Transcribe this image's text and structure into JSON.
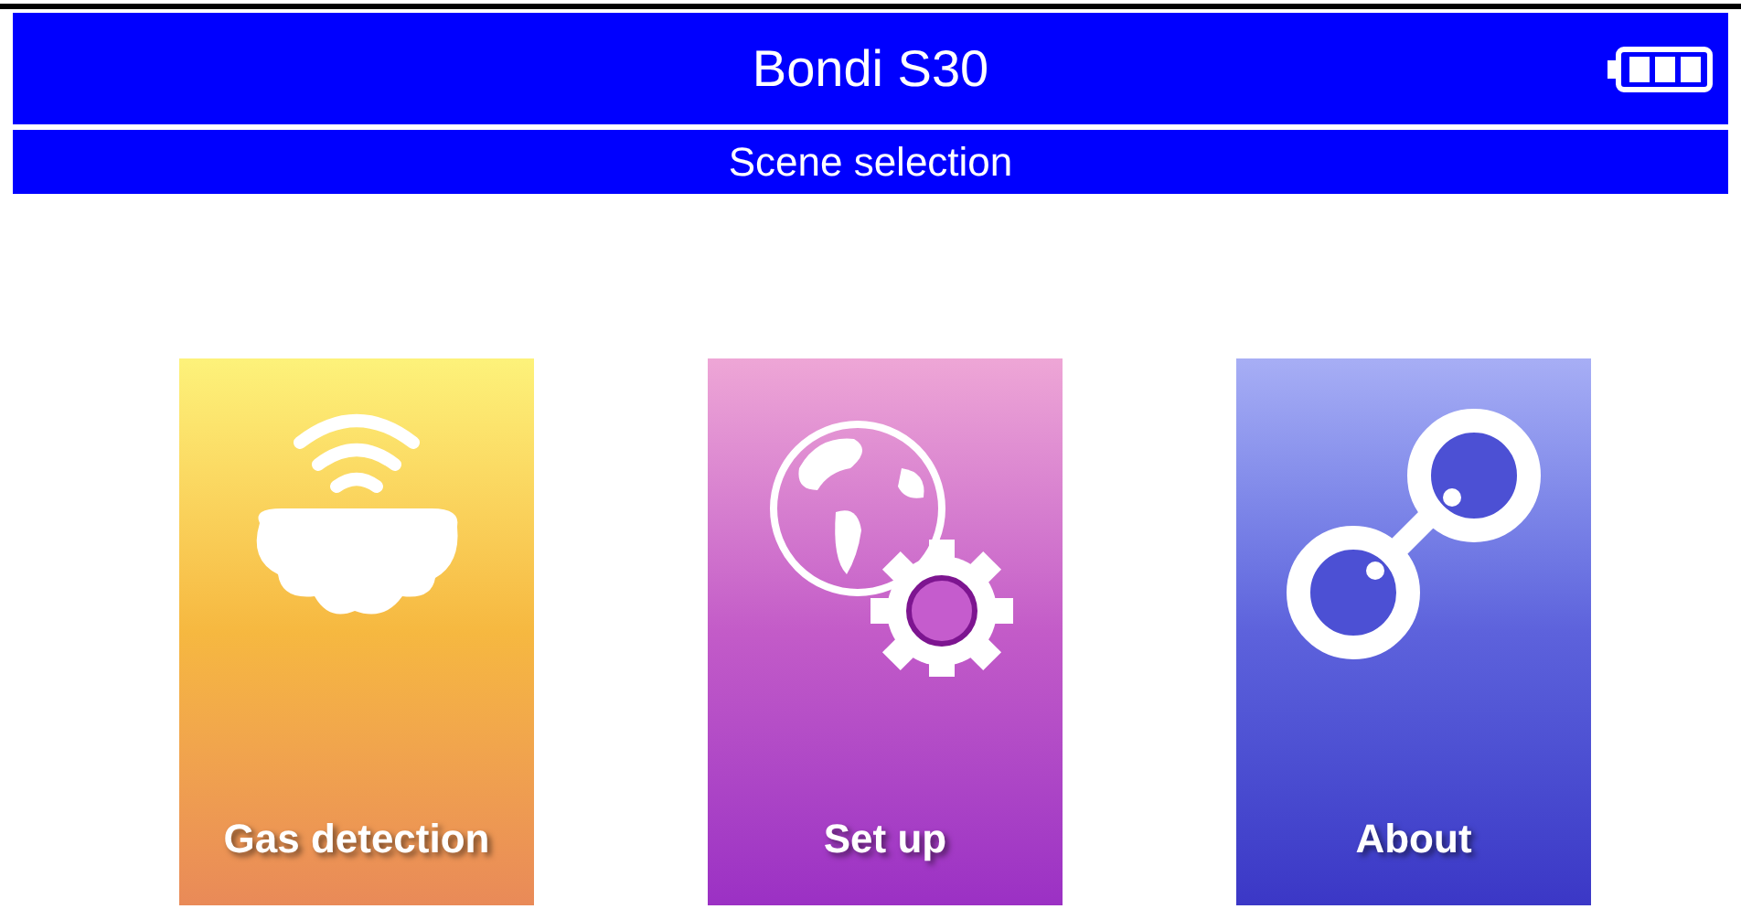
{
  "header": {
    "title": "Bondi S30",
    "subtitle": "Scene selection"
  },
  "tiles": [
    {
      "kind": "gas",
      "label": "Gas detection"
    },
    {
      "kind": "setup",
      "label": "Set up"
    },
    {
      "kind": "about",
      "label": "About"
    }
  ]
}
